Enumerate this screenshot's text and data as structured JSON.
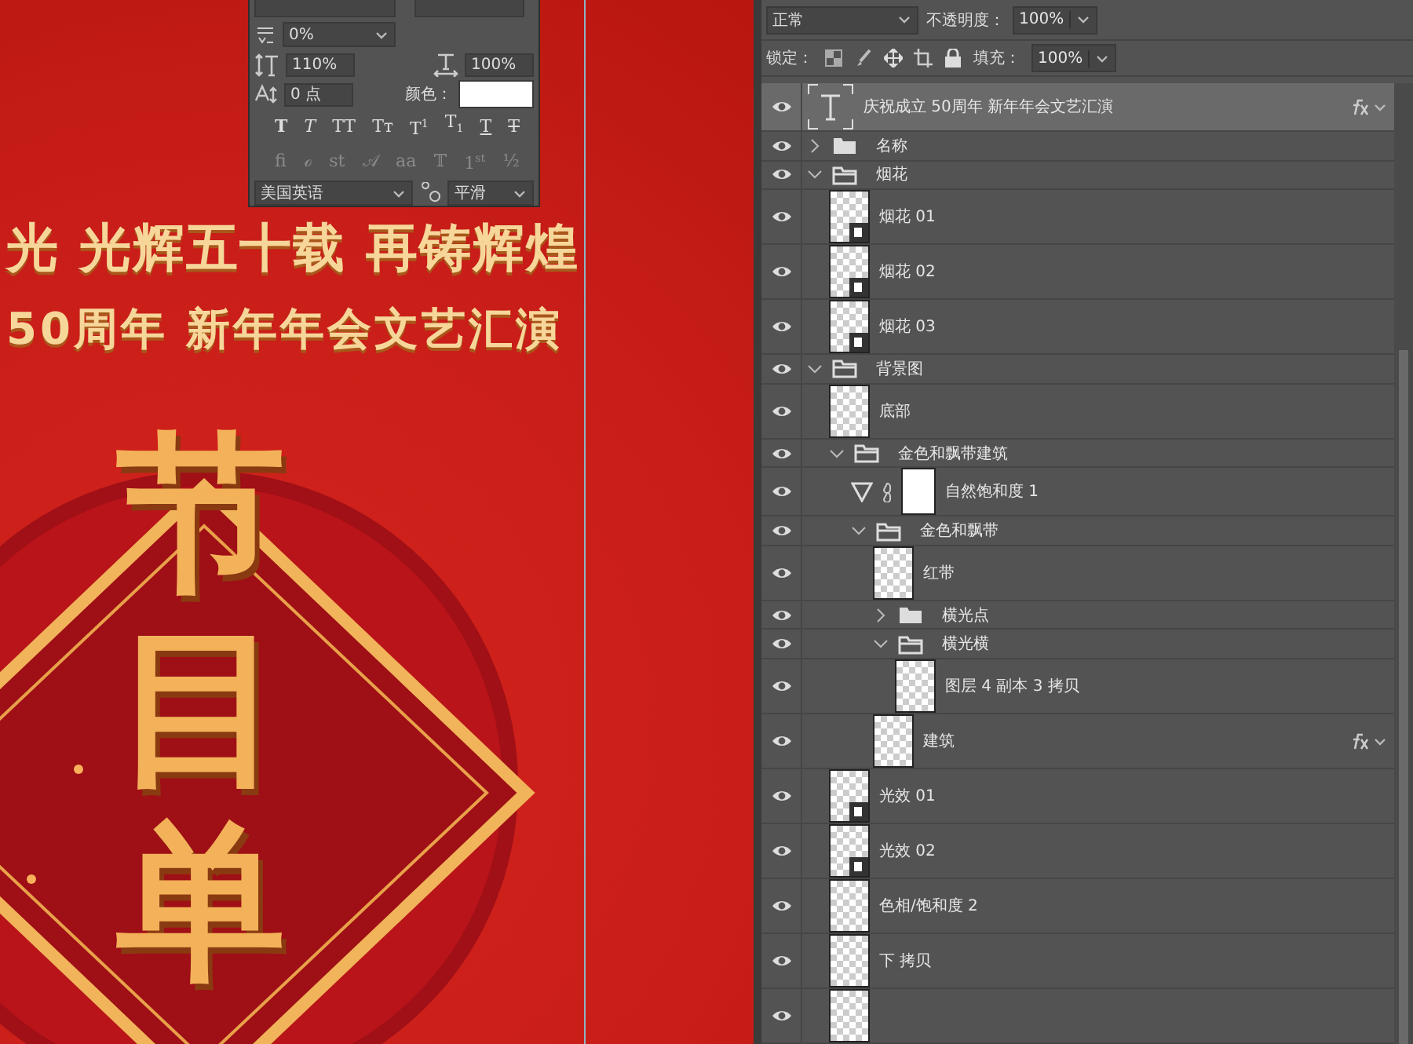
{
  "poster": {
    "headline": "光 光辉五十载 再铸辉煌",
    "subheadline": "50周年 新年年会文艺汇演",
    "title_chars": [
      "节",
      "目",
      "单"
    ]
  },
  "char_panel": {
    "kerning": {
      "value": "0%"
    },
    "vertical_scale": {
      "value": "110%"
    },
    "horizontal_scale": {
      "value": "100%"
    },
    "baseline_shift": {
      "value": "0 点"
    },
    "color": {
      "label": "颜色："
    },
    "style_buttons": [
      {
        "label": "T",
        "kind": "bold"
      },
      {
        "label": "T",
        "kind": "italic"
      },
      {
        "label": "TT",
        "kind": "allcaps"
      },
      {
        "label": "Tт",
        "kind": "smallcaps"
      },
      {
        "label": "T$^{1}$",
        "kind": "superscript"
      },
      {
        "label": "T$_{1}$",
        "kind": "subscript"
      },
      {
        "label": "T",
        "kind": "underline"
      },
      {
        "label": "T",
        "kind": "strikethrough"
      }
    ],
    "opentype_buttons": [
      {
        "label": "fi",
        "disabled": true
      },
      {
        "label": "ℴ",
        "disabled": true
      },
      {
        "label": "st",
        "disabled": true
      },
      {
        "label": "𝒜",
        "disabled": true
      },
      {
        "label": "aa",
        "disabled": true
      },
      {
        "label": "𝕋",
        "disabled": true
      },
      {
        "label": "1$^{st}$",
        "disabled": true
      },
      {
        "label": "½",
        "disabled": true
      }
    ],
    "language": {
      "value": "美国英语"
    },
    "antialias": {
      "value": "平滑"
    }
  },
  "layers_panel": {
    "blend_mode": {
      "value": "正常"
    },
    "opacity": {
      "label": "不透明度：",
      "value": "100%"
    },
    "lock": {
      "label": "锁定："
    },
    "fill": {
      "label": "填充：",
      "value": "100%"
    },
    "layers": [
      {
        "kind": "text",
        "name": "庆祝成立 50周年  新年年会文艺汇演",
        "visible": true,
        "selected": true,
        "effects": true
      },
      {
        "kind": "group",
        "name": "名称",
        "visible": true,
        "selected": false,
        "effects": false,
        "expanded": false
      },
      {
        "kind": "group",
        "name": "烟花",
        "visible": true,
        "selected": false,
        "effects": false,
        "expanded": true,
        "children": [
          {
            "kind": "smart",
            "name": "烟花 01",
            "visible": true,
            "selected": false,
            "effects": false
          },
          {
            "kind": "smart",
            "name": "烟花 02",
            "visible": true,
            "selected": false,
            "effects": false
          },
          {
            "kind": "smart",
            "name": "烟花 03",
            "visible": true,
            "selected": false,
            "effects": false
          }
        ]
      },
      {
        "kind": "group",
        "name": "背景图",
        "visible": true,
        "selected": false,
        "effects": false,
        "expanded": true,
        "children": [
          {
            "kind": "pixel",
            "name": "底部",
            "visible": true,
            "selected": false,
            "effects": false
          },
          {
            "kind": "group",
            "name": "金色和飘带建筑",
            "visible": true,
            "selected": false,
            "effects": false,
            "expanded": true,
            "children": [
              {
                "kind": "adjustment",
                "name": "自然饱和度 1",
                "visible": true,
                "selected": false,
                "effects": false
              },
              {
                "kind": "group",
                "name": "金色和飘带",
                "visible": true,
                "selected": false,
                "effects": false,
                "expanded": true,
                "children": [
                  {
                    "kind": "pixel",
                    "name": "红带",
                    "visible": true,
                    "selected": false,
                    "effects": false
                  },
                  {
                    "kind": "group",
                    "name": "横光点",
                    "visible": true,
                    "selected": false,
                    "effects": false,
                    "expanded": false
                  },
                  {
                    "kind": "group",
                    "name": "横光横",
                    "visible": true,
                    "selected": false,
                    "effects": false,
                    "expanded": true,
                    "children": [
                      {
                        "kind": "pixel",
                        "name": "图层 4 副本 3 拷贝",
                        "visible": true,
                        "selected": false,
                        "effects": false
                      }
                    ]
                  },
                  {
                    "kind": "pixel",
                    "name": "建筑",
                    "visible": true,
                    "selected": false,
                    "effects": true
                  }
                ]
              }
            ]
          },
          {
            "kind": "smart",
            "name": "光效 01",
            "visible": true,
            "selected": false,
            "effects": false
          },
          {
            "kind": "smart",
            "name": "光效 02",
            "visible": true,
            "selected": false,
            "effects": false
          },
          {
            "kind": "pixel",
            "name": "色相/饱和度 2",
            "visible": true,
            "selected": false,
            "effects": false
          },
          {
            "kind": "pixel",
            "name": "下 拷贝",
            "visible": true,
            "selected": false,
            "effects": false
          },
          {
            "kind": "pixel",
            "visible": true,
            "selected": false,
            "effects": false
          }
        ]
      }
    ]
  }
}
